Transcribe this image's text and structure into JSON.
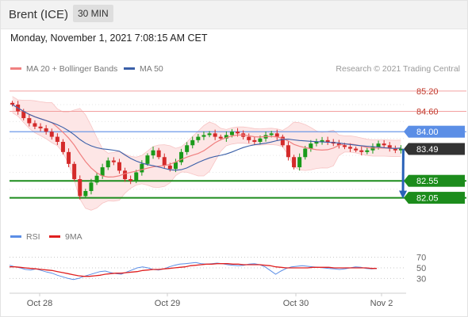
{
  "header": {
    "title": "Brent (ICE)",
    "timeframe": "30 MIN"
  },
  "timestamp": "Monday, November 1, 2021 7:08:15 AM CET",
  "colors": {
    "bollinger": "#f08080",
    "bollinger_band_fill": "#fde6e6",
    "ma50": "#3a5fa8",
    "resistance": "#f3a0a0",
    "resistance_label": "#c0392b",
    "pivot": "#5b8ee6",
    "support": "#1c8c1c",
    "current_price": "#333333",
    "candle_up": "#1a9a1a",
    "candle_down": "#d42a2a",
    "forecast_arrow": "#2a62b8",
    "rsi": "#5b8ee6",
    "rsi_ma": "#e02020"
  },
  "chart_data": [
    {
      "type": "candlestick",
      "legend": {
        "placement": "top-left",
        "items": [
          {
            "label": "MA 20 + Bollinger Bands",
            "color": "#f08080"
          },
          {
            "label": "MA 50",
            "color": "#3a5fa8"
          }
        ]
      },
      "attribution": "Research © 2021 Trading Central",
      "x_labels": [
        "Oct 28",
        "Oct 29",
        "Oct 30",
        "Nov 2"
      ],
      "y_range": [
        81.97,
        85.36
      ],
      "current_price": "83.49",
      "levels": [
        {
          "value": "85.20",
          "kind": "resistance"
        },
        {
          "value": "84.60",
          "kind": "resistance"
        },
        {
          "value": "84.00",
          "kind": "pivot"
        },
        {
          "value": "82.55",
          "kind": "support"
        },
        {
          "value": "82.05",
          "kind": "support"
        }
      ],
      "forecast": {
        "from": 83.49,
        "to": 82.05
      },
      "price_series": [
        84.8,
        84.6,
        84.4,
        84.25,
        84.15,
        84.1,
        84.0,
        83.85,
        83.7,
        83.4,
        83.05,
        82.6,
        82.1,
        82.25,
        82.5,
        82.7,
        82.95,
        83.15,
        83.1,
        82.85,
        82.6,
        82.55,
        82.8,
        83.05,
        83.3,
        83.45,
        83.25,
        83.0,
        82.9,
        83.1,
        83.4,
        83.6,
        83.75,
        83.85,
        83.9,
        83.95,
        83.85,
        83.8,
        83.9,
        84.0,
        83.95,
        83.85,
        83.75,
        83.7,
        83.8,
        83.9,
        83.95,
        83.85,
        83.6,
        83.25,
        82.95,
        83.25,
        83.5,
        83.65,
        83.7,
        83.75,
        83.7,
        83.65,
        83.6,
        83.55,
        83.5,
        83.45,
        83.4,
        83.45,
        83.55,
        83.65,
        83.6,
        83.5,
        83.45,
        83.5
      ]
    },
    {
      "type": "line",
      "legend": {
        "placement": "top-left",
        "items": [
          {
            "label": "RSI",
            "color": "#5b8ee6"
          },
          {
            "label": "9MA",
            "color": "#e02020"
          }
        ]
      },
      "y_ticks": [
        "70",
        "50",
        "30"
      ],
      "y_range": [
        20,
        80
      ],
      "rsi": [
        55,
        52,
        50,
        47,
        46,
        48,
        45,
        42,
        40,
        36,
        33,
        30,
        28,
        30,
        34,
        37,
        40,
        43,
        44,
        41,
        39,
        38,
        42,
        46,
        50,
        52,
        50,
        47,
        46,
        48,
        52,
        55,
        57,
        58,
        59,
        60,
        58,
        57,
        58,
        59,
        58,
        56,
        55,
        54,
        55,
        57,
        58,
        56,
        52,
        45,
        38,
        44,
        49,
        52,
        53,
        54,
        53,
        52,
        51,
        50,
        49,
        48,
        47,
        48,
        50,
        52,
        51,
        49,
        48,
        49
      ],
      "rsi_ma": [
        52,
        52,
        51,
        50,
        49,
        48,
        47,
        46,
        45,
        43,
        41,
        39,
        37,
        35,
        34,
        34,
        35,
        36,
        38,
        39,
        40,
        40,
        41,
        42,
        43,
        45,
        46,
        47,
        47,
        48,
        49,
        50,
        51,
        52,
        54,
        55,
        56,
        57,
        57,
        58,
        58,
        58,
        57,
        57,
        56,
        56,
        56,
        56,
        55,
        54,
        52,
        51,
        50,
        50,
        50,
        50,
        50,
        51,
        51,
        51,
        51,
        50,
        50,
        50,
        50,
        50,
        50,
        50,
        49,
        49
      ]
    }
  ]
}
